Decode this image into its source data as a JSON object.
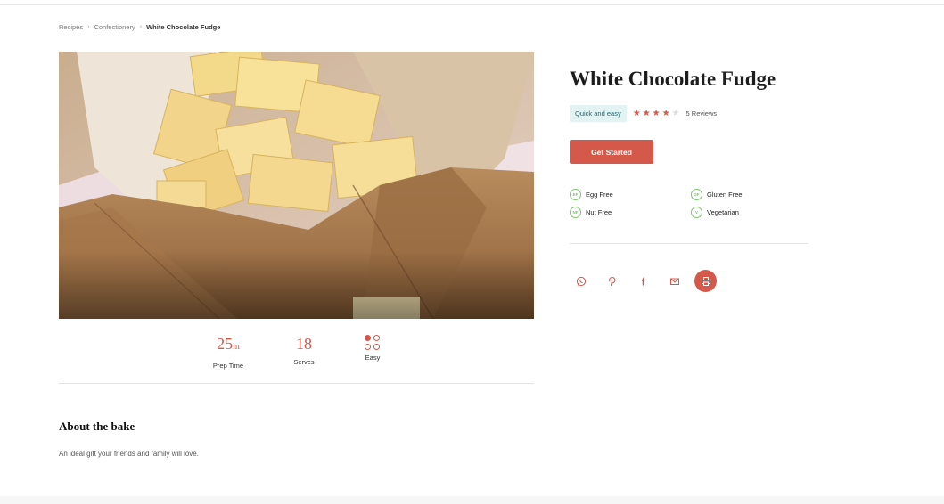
{
  "breadcrumb": {
    "items": [
      "Recipes",
      "Confectionery"
    ],
    "separator": "›",
    "current": "White Chocolate Fudge"
  },
  "recipe": {
    "title": "White Chocolate Fudge",
    "tag": "Quick and easy",
    "rating": 4,
    "rating_max": 5,
    "reviews": "5 Reviews",
    "cta_label": "Get Started",
    "diets": [
      {
        "code": "EF",
        "label": "Egg Free"
      },
      {
        "code": "GF",
        "label": "Gluten Free"
      },
      {
        "code": "NF",
        "label": "Nut Free"
      },
      {
        "code": "V",
        "label": "Vegetarian"
      }
    ]
  },
  "stats": {
    "prep": {
      "value": "25",
      "unit": "m",
      "label": "Prep Time"
    },
    "serves": {
      "value": "18",
      "label": "Serves"
    },
    "difficulty": {
      "label": "Easy",
      "level": 1,
      "max": 4
    }
  },
  "about": {
    "title": "About the bake",
    "text": "An ideal gift your friends and family will love."
  },
  "share": [
    "whatsapp-icon",
    "pinterest-icon",
    "facebook-icon",
    "email-icon",
    "print-icon"
  ],
  "colors": {
    "accent": "#d4594a",
    "tag_bg": "#e3f3f4",
    "tag_text": "#1f6b6e",
    "diet_green": "#7cc46b"
  }
}
